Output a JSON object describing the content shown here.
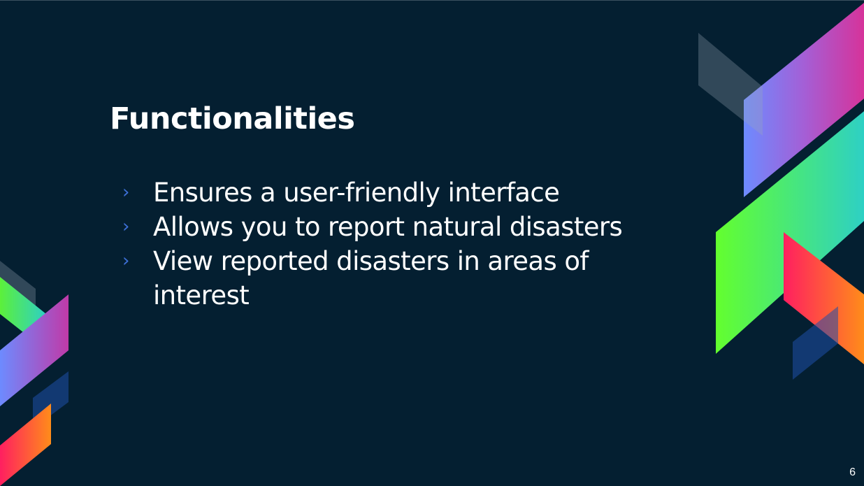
{
  "slide": {
    "title": "Functionalities",
    "bullets": [
      {
        "marker": "›",
        "text": "Ensures a user-friendly interface"
      },
      {
        "marker": "›",
        "text": "Allows you to report natural disasters"
      },
      {
        "marker": "›",
        "text": "View reported disasters in areas of interest"
      }
    ],
    "page_number": "6"
  },
  "colors": {
    "background": "#041f31",
    "text": "#ffffff",
    "bullet_marker": "#3d6fd6"
  }
}
